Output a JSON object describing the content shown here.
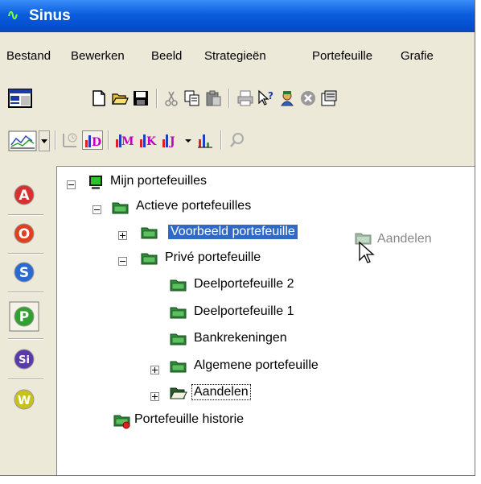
{
  "window": {
    "title": "Sinus",
    "logo_glyph": "∿"
  },
  "menu": [
    {
      "label": "Bestand"
    },
    {
      "label": "Bewerken"
    },
    {
      "label": "Beeld"
    },
    {
      "label": "Strategieën"
    },
    {
      "label": "Portefeuille"
    },
    {
      "label": "Grafie"
    }
  ],
  "toolbar1": [
    "window-layout-icon",
    "new-document-icon",
    "open-folder-icon",
    "save-icon",
    "cut-icon",
    "copy-icon",
    "paste-icon",
    "print-icon",
    "help-pointer-icon",
    "person-icon",
    "stop-icon",
    "properties-icon"
  ],
  "toolbar2": [
    "line-chart-icon",
    "dropdown-arrow-icon",
    "history-chart-icon",
    "d-chart-icon",
    "m-chart-icon",
    "k-chart-icon",
    "j-chart-icon",
    "dropdown-arrow-icon",
    "bar-chart-icon",
    "zoom-icon"
  ],
  "sidebar": [
    {
      "letter": "A",
      "color": "#d83030"
    },
    {
      "letter": "O",
      "color": "#e04020"
    },
    {
      "letter": "S",
      "color": "#2a6ad0"
    },
    {
      "letter": "P",
      "color": "#30a030"
    },
    {
      "letter": "Si",
      "color": "#5a3aa8"
    },
    {
      "letter": "W",
      "color": "#c8c020"
    }
  ],
  "tree": {
    "root": "Mijn portefeuilles",
    "active": "Actieve portefeuilles",
    "voorbeeld": "Voorbeeld portefeuille",
    "prive": "Privé portefeuille",
    "deel2": "Deelportefeuille 2",
    "deel1": "Deelportefeuille 1",
    "bank": "Bankrekeningen",
    "algemeen": "Algemene portefeuille",
    "aandelen": "Aandelen",
    "historie": "Portefeuille historie"
  },
  "drag_ghost": {
    "label": "Aandelen"
  },
  "colors": {
    "selection": "#316ac5",
    "titlebar": "#0a5ddc",
    "folder": "#2e8a3a"
  }
}
